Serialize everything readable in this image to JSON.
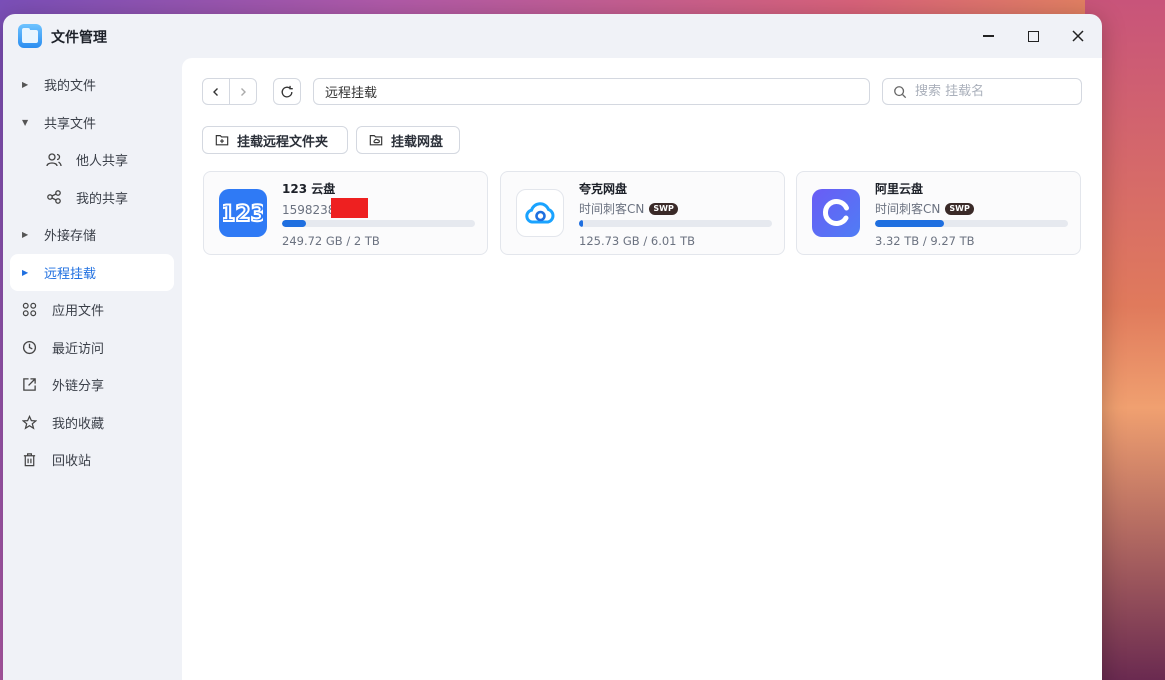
{
  "window": {
    "title": "文件管理"
  },
  "sidebar": {
    "items": [
      {
        "label": "我的文件",
        "icon": "caret-right-icon",
        "active": false
      },
      {
        "label": "共享文件",
        "icon": "caret-down-icon",
        "active": false
      },
      {
        "label": "他人共享",
        "icon": "users-icon",
        "active": false
      },
      {
        "label": "我的共享",
        "icon": "share-icon",
        "active": false
      },
      {
        "label": "外接存储",
        "icon": "caret-right-icon",
        "active": false
      },
      {
        "label": "远程挂载",
        "icon": "caret-right-icon",
        "active": true
      },
      {
        "label": "应用文件",
        "icon": "apps-icon",
        "active": false
      },
      {
        "label": "最近访问",
        "icon": "clock-icon",
        "active": false
      },
      {
        "label": "外链分享",
        "icon": "external-link-icon",
        "active": false
      },
      {
        "label": "我的收藏",
        "icon": "star-icon",
        "active": false
      },
      {
        "label": "回收站",
        "icon": "trash-icon",
        "active": false
      }
    ]
  },
  "toolbar": {
    "path": "远程挂载",
    "search_placeholder": "搜索 挂载名"
  },
  "actions": {
    "mount_remote_folder": "挂载远程文件夹",
    "mount_cloud_drive": "挂载网盘"
  },
  "cards": [
    {
      "title": "123 云盘",
      "subtitle": "1598238",
      "redacted": true,
      "badge": "",
      "size": "249.72 GB / 2 TB",
      "usage_fraction": 0.122,
      "logo": "123-cloud-logo-icon",
      "color": "#2f7af5"
    },
    {
      "title": "夸克网盘",
      "subtitle": "时间刺客CN",
      "redacted": false,
      "badge": "SWP",
      "size": "125.73 GB / 6.01 TB",
      "usage_fraction": 0.021,
      "logo": "quark-cloud-logo-icon",
      "color": "#1f6fe0"
    },
    {
      "title": "阿里云盘",
      "subtitle": "时间刺客CN",
      "redacted": false,
      "badge": "SWP",
      "size": "3.32 TB / 9.27 TB",
      "usage_fraction": 0.358,
      "logo": "aliyun-drive-logo-icon",
      "color": "#5b5cf0"
    }
  ],
  "colors": {
    "accent": "#1f6fe0",
    "progress_track": "#e6e9ef",
    "redaction": "#ee2020"
  }
}
